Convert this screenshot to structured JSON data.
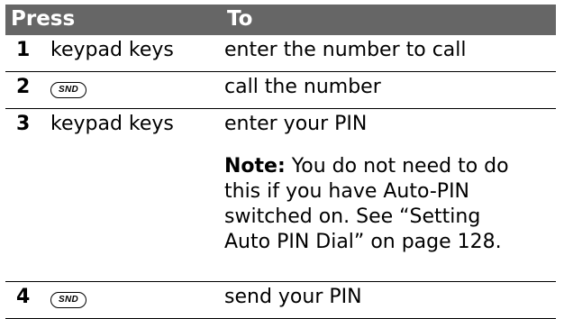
{
  "header": {
    "press_label": "Press",
    "to_label": "To",
    "background_color": "#666666"
  },
  "rows": [
    {
      "number": "1",
      "press": "keypad keys",
      "to": "enter the number to call"
    },
    {
      "number": "2",
      "press_icon": "send-key-icon",
      "press_icon_text": "SND",
      "to": "call the number"
    },
    {
      "number": "3",
      "press": "keypad keys",
      "to": "enter your PIN",
      "note_label": "Note:",
      "note_text": " You do not need to do this if you have Auto-PIN switched on. See “Setting Auto PIN Dial” on page 128."
    },
    {
      "number": "4",
      "press_icon": "send-key-icon",
      "press_icon_text": "SND",
      "to": "send your PIN"
    }
  ]
}
